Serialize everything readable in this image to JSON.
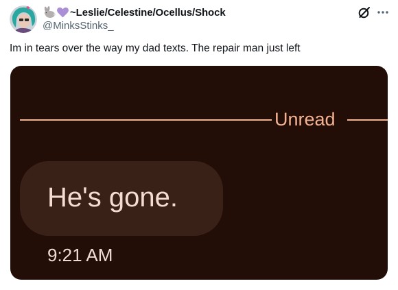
{
  "author": {
    "display_name": "~Leslie/Celestine/Ocellus/Shock",
    "handle": "@MinksStinks_",
    "name_emojis": [
      "rabbit-emoji",
      "purple-heart-emoji"
    ]
  },
  "post": {
    "text": "Im in tears over the way my dad texts. The repair man just left"
  },
  "media": {
    "divider_label": "Unread",
    "message_text": "He's gone.",
    "timestamp": "9:21 AM",
    "colors": {
      "background": "#220d07",
      "bubble": "#3a2118",
      "accent": "#f3b291",
      "message_text": "#f5dcd3"
    }
  },
  "actions": {
    "grok_icon": "grok-icon",
    "more_icon": "more-options-icon"
  }
}
